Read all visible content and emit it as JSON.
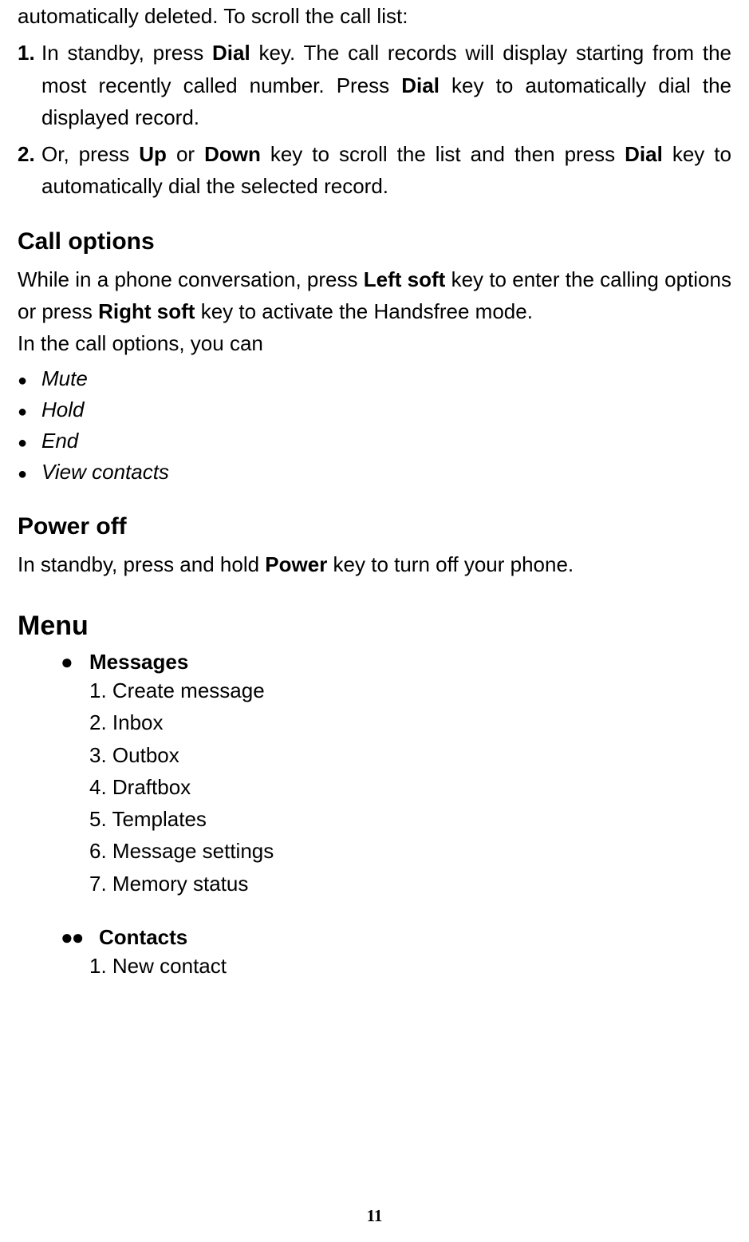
{
  "intro_line": "automatically deleted. To scroll the call list:",
  "steps": [
    {
      "num": "1.",
      "segments": [
        {
          "t": "In standby, press ",
          "b": false
        },
        {
          "t": "Dial",
          "b": true
        },
        {
          "t": " key. The call records will display starting from the most recently called number. Press ",
          "b": false
        },
        {
          "t": "Dial",
          "b": true
        },
        {
          "t": " key to automatically dial the displayed record.",
          "b": false
        }
      ]
    },
    {
      "num": "2.",
      "segments": [
        {
          "t": "Or, press ",
          "b": false
        },
        {
          "t": "Up",
          "b": true
        },
        {
          "t": " or ",
          "b": false
        },
        {
          "t": "Down",
          "b": true
        },
        {
          "t": " key to scroll the list and then press ",
          "b": false
        },
        {
          "t": "Dial",
          "b": true
        },
        {
          "t": " key to automatically dial the selected record.",
          "b": false
        }
      ]
    }
  ],
  "call_options": {
    "heading": "Call options",
    "para_segments": [
      {
        "t": "While in a phone conversation, press ",
        "b": false
      },
      {
        "t": "Left soft",
        "b": true
      },
      {
        "t": " key to enter the calling options or press ",
        "b": false
      },
      {
        "t": "Right soft",
        "b": true
      },
      {
        "t": " key to activate the Handsfree mode.",
        "b": false
      }
    ],
    "lead_in": "In the call options, you can",
    "bullets": [
      "Mute",
      "Hold",
      "End",
      "View contacts"
    ]
  },
  "power_off": {
    "heading": "Power off",
    "para_segments": [
      {
        "t": "In standby, press and hold ",
        "b": false
      },
      {
        "t": "Power",
        "b": true
      },
      {
        "t": " key to turn off your phone.",
        "b": false
      }
    ]
  },
  "menu": {
    "heading": "Menu",
    "groups": [
      {
        "dots": "●",
        "name": "Messages",
        "items": [
          "1. Create message",
          "2. Inbox",
          "3. Outbox",
          "4. Draftbox",
          "5. Templates",
          "6. Message settings",
          "7. Memory status"
        ]
      },
      {
        "dots": "●●",
        "name": "Contacts",
        "items": [
          "1. New contact"
        ]
      }
    ]
  },
  "page_number": "11"
}
